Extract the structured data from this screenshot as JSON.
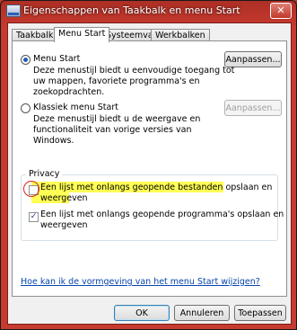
{
  "window": {
    "title": "Eigenschappen van Taakbalk en menu Start",
    "close_glyph": "✕"
  },
  "tabs": [
    {
      "label": "Taakbalk"
    },
    {
      "label": "Menu Start"
    },
    {
      "label": "Systeemvak"
    },
    {
      "label": "Werkbalken"
    }
  ],
  "menu_start": {
    "option1": {
      "label": "Menu Start",
      "description_lines": [
        "Deze menustijl biedt u eenvoudige toegang tot",
        "uw mappen, favoriete programma's en",
        "zoekopdrachten."
      ],
      "button": "Aanpassen..."
    },
    "option2": {
      "label": "Klassiek menu Start",
      "description_lines": [
        "Deze menustijl biedt u de weergave en",
        "functionaliteit van vorige versies van",
        "Windows."
      ],
      "button": "Aanpassen..."
    }
  },
  "privacy": {
    "title": "Privacy",
    "item1_lines": [
      "Een lijst met onlangs geopende bestanden opslaan en",
      "weergeven"
    ],
    "item2_lines": [
      "Een lijst met onlangs geopende programma's opslaan en",
      "weergeven"
    ],
    "check_glyph": "✓"
  },
  "link": "Hoe kan ik de vormgeving van het menu Start wijzigen?",
  "buttons": {
    "ok": "OK",
    "cancel": "Annuleren",
    "apply": "Toepassen"
  },
  "colors": {
    "highlight": "#ffff55",
    "annotation_circle": "#dd2222",
    "window_frame": "#c63a2f"
  }
}
